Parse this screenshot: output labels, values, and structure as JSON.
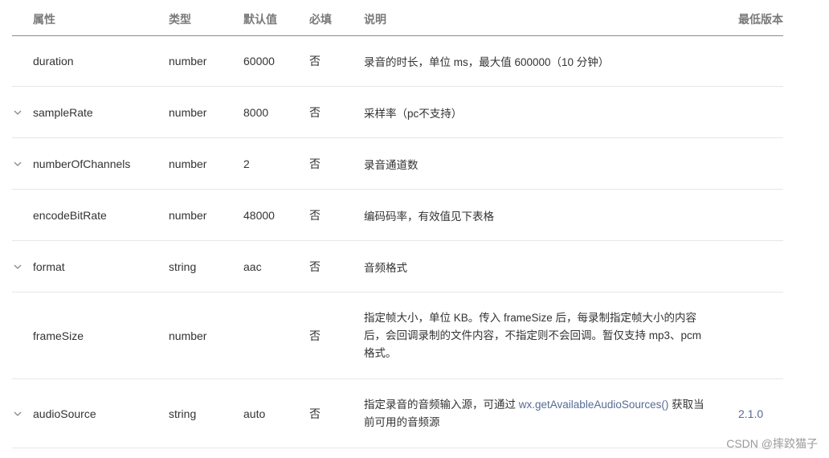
{
  "header": {
    "name": "属性",
    "type": "类型",
    "default": "默认值",
    "required": "必填",
    "desc": "说明",
    "version": "最低版本"
  },
  "rows": [
    {
      "name": "duration",
      "type": "number",
      "default": "60000",
      "required": "否",
      "desc": "录音的时长，单位 ms，最大值 600000（10 分钟）",
      "version": "",
      "expandable": false
    },
    {
      "name": "sampleRate",
      "type": "number",
      "default": "8000",
      "required": "否",
      "desc": "采样率（pc不支持）",
      "version": "",
      "expandable": true
    },
    {
      "name": "numberOfChannels",
      "type": "number",
      "default": "2",
      "required": "否",
      "desc": "录音通道数",
      "version": "",
      "expandable": true
    },
    {
      "name": "encodeBitRate",
      "type": "number",
      "default": "48000",
      "required": "否",
      "desc": "编码码率，有效值见下表格",
      "version": "",
      "expandable": false
    },
    {
      "name": "format",
      "type": "string",
      "default": "aac",
      "required": "否",
      "desc": "音频格式",
      "version": "",
      "expandable": true
    },
    {
      "name": "frameSize",
      "type": "number",
      "default": "",
      "required": "否",
      "desc": "指定帧大小，单位 KB。传入 frameSize 后，每录制指定帧大小的内容后，会回调录制的文件内容，不指定则不会回调。暂仅支持 mp3、pcm 格式。",
      "version": "",
      "expandable": false
    },
    {
      "name": "audioSource",
      "type": "string",
      "default": "auto",
      "required": "否",
      "desc_prefix": "指定录音的音频输入源，可通过 ",
      "desc_link": "wx.getAvailableAudioSources()",
      "desc_suffix": " 获取当前可用的音频源",
      "version": "2.1.0",
      "expandable": true
    }
  ],
  "watermark": "CSDN @摔跤猫子",
  "icons": {
    "expand": "chevron-down-icon"
  },
  "colors": {
    "link": "#576b95",
    "header_border": "#8a8a8a",
    "row_border": "#e6e6e6"
  }
}
